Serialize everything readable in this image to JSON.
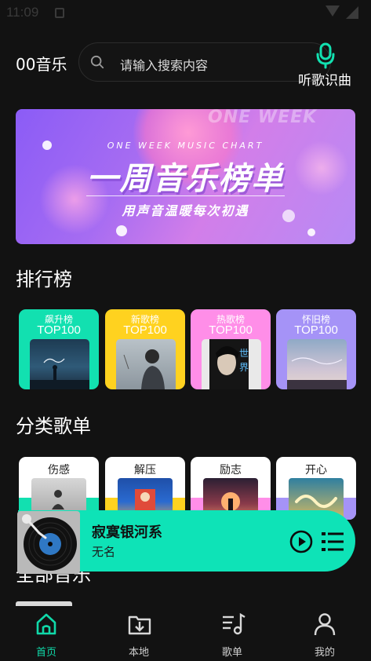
{
  "status_bar": {
    "time": "11:09"
  },
  "header": {
    "app_title": "00音乐",
    "search_placeholder": "请输入搜索内容",
    "mic_label": "听歌识曲"
  },
  "banner": {
    "watermark": "ONE WEEK",
    "subtitle": "ONE WEEK MUSIC CHART",
    "title": "一周音乐榜单",
    "tagline": "用声音温暖每次初遇"
  },
  "rankings": {
    "title": "排行榜",
    "items": [
      {
        "name": "飙升榜",
        "top": "TOP100",
        "color": "#12e0b0"
      },
      {
        "name": "新歌榜",
        "top": "TOP100",
        "color": "#ffd21f"
      },
      {
        "name": "热歌榜",
        "top": "TOP100",
        "color": "#ff8ee8"
      },
      {
        "name": "怀旧榜",
        "top": "TOP100",
        "color": "#a593f7"
      }
    ]
  },
  "categories": {
    "title": "分类歌单",
    "items": [
      {
        "name": "伤感",
        "color": "#12e0b0"
      },
      {
        "name": "解压",
        "color": "#ffd21f"
      },
      {
        "name": "励志",
        "color": "#ff8ee8"
      },
      {
        "name": "开心",
        "color": "#a593f7"
      }
    ]
  },
  "all_music": {
    "title": "全部音乐"
  },
  "player": {
    "song_title": "寂寞银河系",
    "artist": "无名",
    "accent": "#0ee3b7"
  },
  "nav": {
    "items": [
      {
        "label": "首页",
        "icon": "home-icon",
        "active": true
      },
      {
        "label": "本地",
        "icon": "folder-download-icon"
      },
      {
        "label": "歌单",
        "icon": "playlist-music-icon"
      },
      {
        "label": "我的",
        "icon": "person-icon"
      }
    ],
    "active_color": "#10d9a9"
  }
}
